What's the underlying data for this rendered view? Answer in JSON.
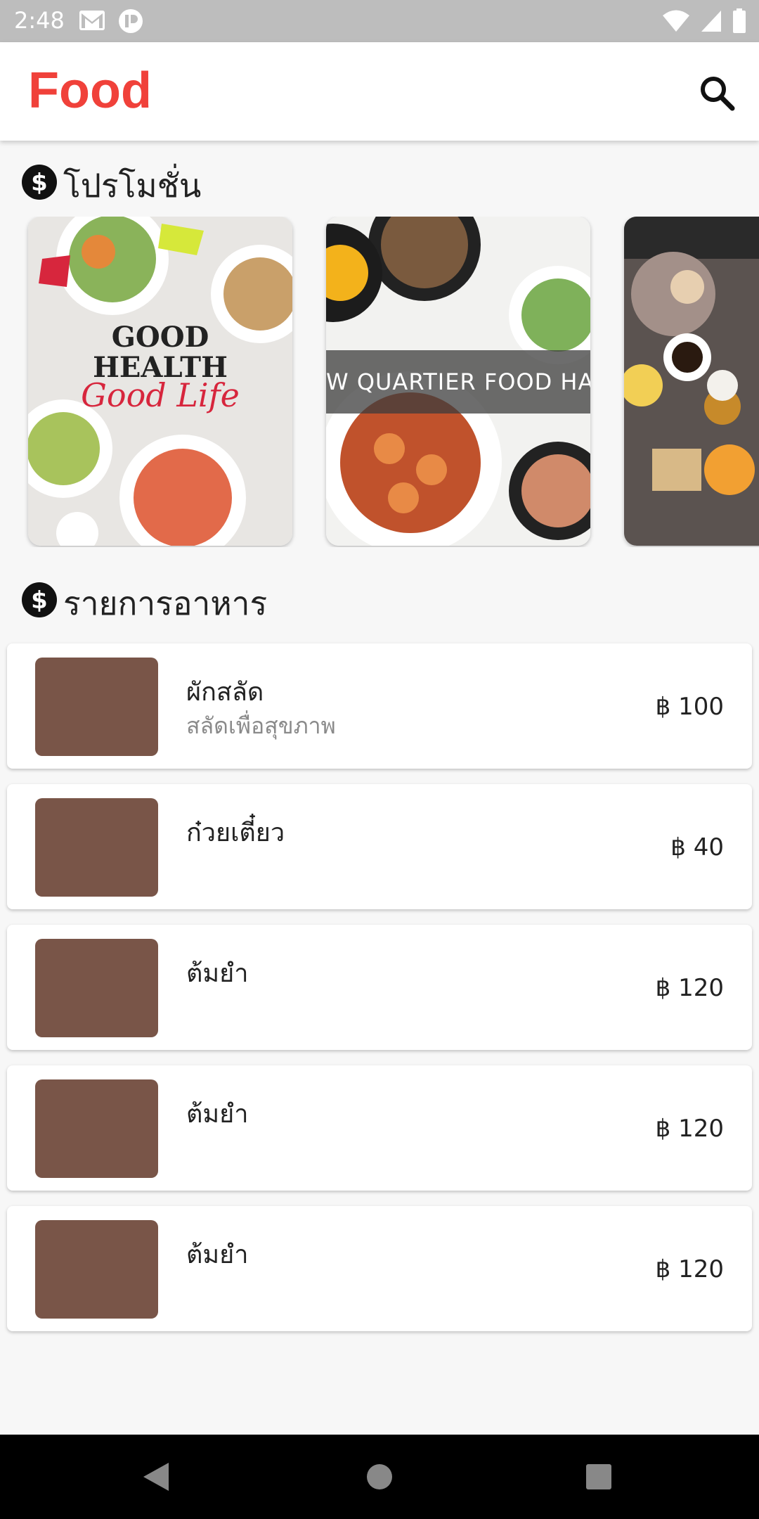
{
  "status_bar": {
    "time": "2:48",
    "left_icons": [
      "gmail-icon",
      "app-notification-icon"
    ],
    "right_icons": [
      "wifi-icon",
      "signal-icon",
      "battery-icon"
    ]
  },
  "app_bar": {
    "title": "Food",
    "title_color": "#f0413a",
    "search_icon": "search-icon"
  },
  "promotions": {
    "title": "โปรโมชั่น",
    "icon": "dollar-circle-icon",
    "cards": [
      {
        "image": "good-health-poster"
      },
      {
        "image": "food-hall-photo",
        "banner_text": "W QUARTIER FOOD HA"
      },
      {
        "image": "breakfast-table-photo"
      }
    ]
  },
  "menu": {
    "title": "รายการอาหาร",
    "icon": "dollar-circle-icon",
    "thumb_color": "#795548",
    "items": [
      {
        "name": "ผักสลัด",
        "description": "สลัดเพื่อสุขภาพ",
        "price": "฿ 100"
      },
      {
        "name": "ก๋วยเตี๋ยว",
        "description": "",
        "price": "฿ 40"
      },
      {
        "name": "ต้มยำ",
        "description": "",
        "price": "฿ 120"
      },
      {
        "name": "ต้มยำ",
        "description": "",
        "price": "฿ 120"
      },
      {
        "name": "ต้มยำ",
        "description": "",
        "price": "฿ 120"
      }
    ]
  },
  "nav_bar": {
    "buttons": [
      "back-icon",
      "home-icon",
      "recents-icon"
    ]
  }
}
